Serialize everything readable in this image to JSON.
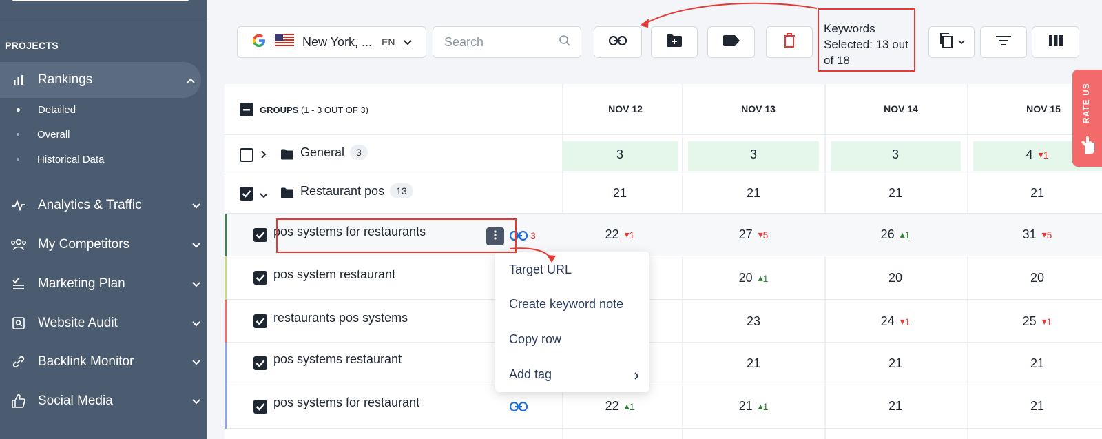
{
  "sidebar": {
    "section_title": "PROJECTS",
    "items": [
      {
        "label": "Rankings",
        "icon": "bar-chart-icon"
      },
      {
        "label": "Analytics & Traffic",
        "icon": "pulse-icon"
      },
      {
        "label": "My Competitors",
        "icon": "users-icon"
      },
      {
        "label": "Marketing Plan",
        "icon": "checklist-icon"
      },
      {
        "label": "Website Audit",
        "icon": "audit-icon"
      },
      {
        "label": "Backlink Monitor",
        "icon": "link-icon"
      },
      {
        "label": "Social Media",
        "icon": "thumbs-up-icon"
      }
    ],
    "subitems": [
      {
        "label": "Detailed"
      },
      {
        "label": "Overall"
      },
      {
        "label": "Historical Data"
      }
    ]
  },
  "toolbar": {
    "location": "New York, ...",
    "language": "EN",
    "search_placeholder": "Search",
    "keywords_selected": "Keywords Selected: 13 out of 18"
  },
  "table": {
    "groups_header": "GROUPS",
    "groups_count": "(1 - 3 OUT OF 3)",
    "dates": [
      "NOV 12",
      "NOV 13",
      "NOV 14",
      "NOV 15"
    ],
    "groups": [
      {
        "name": "General",
        "count": "3",
        "values": [
          "3",
          "3",
          "3",
          "4"
        ],
        "deltas": [
          "",
          "",
          "",
          "1"
        ]
      },
      {
        "name": "Restaurant pos",
        "count": "13",
        "values": [
          "21",
          "21",
          "21",
          "21"
        ]
      }
    ],
    "keywords": [
      {
        "name": "pos systems for restaurants",
        "links": "3",
        "values": [
          "22",
          "27",
          "26",
          "31"
        ],
        "deltas": [
          "1",
          "5",
          "1",
          "5"
        ]
      },
      {
        "name": "pos system restaurant",
        "values": [
          "",
          "20",
          "20",
          "20"
        ],
        "deltas": [
          "",
          "1",
          "",
          ""
        ]
      },
      {
        "name": "restaurants pos systems",
        "values": [
          "",
          "23",
          "24",
          "25"
        ],
        "deltas": [
          "",
          "",
          "1",
          "1"
        ]
      },
      {
        "name": "pos systems restaurant",
        "values": [
          "",
          "21",
          "21",
          "21"
        ],
        "deltas": [
          "",
          "",
          "",
          ""
        ]
      },
      {
        "name": "pos systems for restaurant",
        "values": [
          "22",
          "21",
          "21",
          "21"
        ],
        "deltas": [
          "1",
          "1",
          "",
          ""
        ]
      }
    ]
  },
  "context_menu": {
    "items": [
      "Target URL",
      "Create keyword note",
      "Copy row",
      "Add tag"
    ]
  },
  "rate_us": "RATE US"
}
